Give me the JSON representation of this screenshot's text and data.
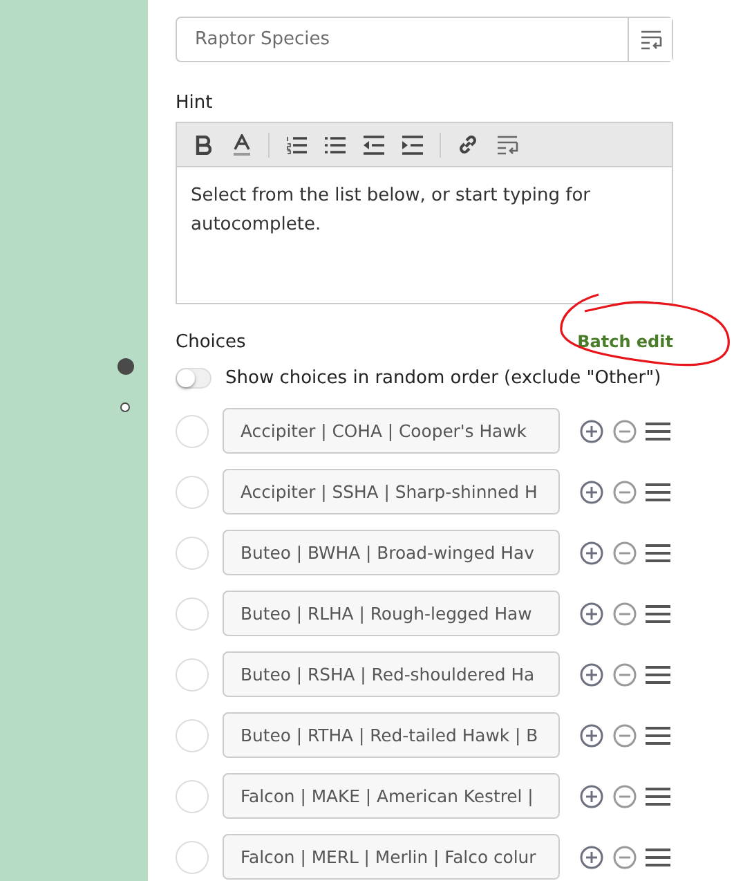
{
  "label_field": {
    "value": "Raptor Species"
  },
  "hint": {
    "label": "Hint",
    "text": "Select from the list below, or start typing for autocomplete."
  },
  "choices": {
    "title": "Choices",
    "batch_edit": "Batch edit",
    "random_order": {
      "label": "Show choices in random order (exclude \"Other\")",
      "on": false
    },
    "items": [
      {
        "value": "Accipiter | COHA | Cooper's Hawk",
        "selected": false
      },
      {
        "value": "Accipiter | SSHA | Sharp-shinned H",
        "selected": false
      },
      {
        "value": "Buteo | BWHA | Broad-winged Hav",
        "selected": false
      },
      {
        "value": "Buteo | RLHA | Rough-legged Haw",
        "selected": false
      },
      {
        "value": "Buteo | RSHA | Red-shouldered Ha",
        "selected": false
      },
      {
        "value": "Buteo | RTHA | Red-tailed Hawk | B",
        "selected": false
      },
      {
        "value": "Falcon | MAKE | American Kestrel |",
        "selected": false
      },
      {
        "value": "Falcon | MERL | Merlin | Falco colur",
        "selected": false
      }
    ]
  },
  "side_markers": [
    {
      "selected": true
    },
    {
      "selected": false
    }
  ]
}
